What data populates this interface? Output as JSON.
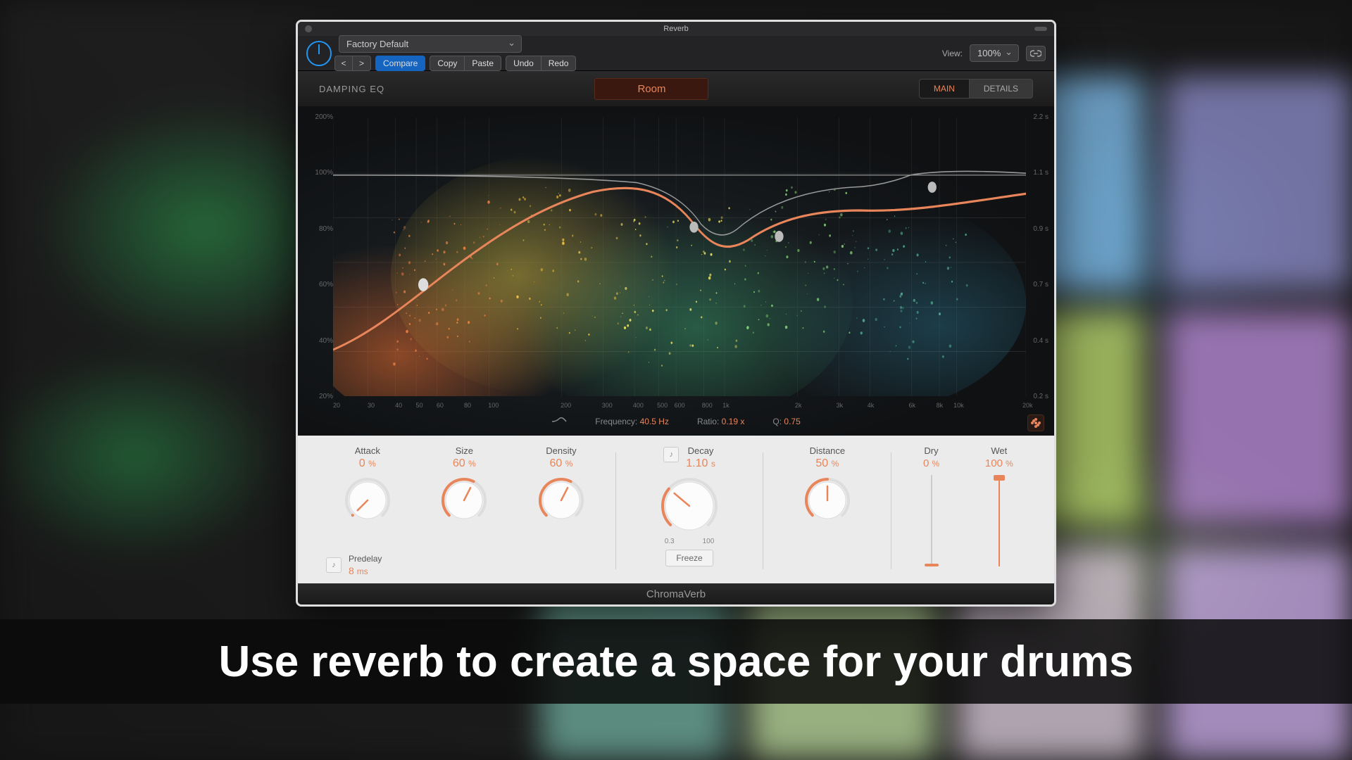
{
  "window": {
    "title": "Reverb"
  },
  "toolbar": {
    "preset": "Factory Default",
    "compare": "Compare",
    "copy": "Copy",
    "paste": "Paste",
    "undo": "Undo",
    "redo": "Redo",
    "view_label": "View:",
    "view_value": "100%"
  },
  "header": {
    "eq_label": "DAMPING EQ",
    "preset_name": "Room",
    "tab_main": "MAIN",
    "tab_details": "DETAILS"
  },
  "graph": {
    "y_left": [
      "200%",
      "100%",
      "80%",
      "60%",
      "40%",
      "20%"
    ],
    "y_right": [
      "2.2 s",
      "1.1 s",
      "0.9 s",
      "0.7 s",
      "0.4 s",
      "0.2 s"
    ],
    "x_ticks": [
      {
        "label": "20",
        "pos": 0
      },
      {
        "label": "30",
        "pos": 5
      },
      {
        "label": "40",
        "pos": 9
      },
      {
        "label": "50",
        "pos": 12
      },
      {
        "label": "60",
        "pos": 15
      },
      {
        "label": "80",
        "pos": 19
      },
      {
        "label": "100",
        "pos": 22.5
      },
      {
        "label": "200",
        "pos": 33
      },
      {
        "label": "300",
        "pos": 39
      },
      {
        "label": "400",
        "pos": 43.5
      },
      {
        "label": "500",
        "pos": 47
      },
      {
        "label": "600",
        "pos": 49.5
      },
      {
        "label": "800",
        "pos": 53.5
      },
      {
        "label": "1k",
        "pos": 56.5
      },
      {
        "label": "2k",
        "pos": 67
      },
      {
        "label": "3k",
        "pos": 73
      },
      {
        "label": "4k",
        "pos": 77.5
      },
      {
        "label": "6k",
        "pos": 83.5
      },
      {
        "label": "8k",
        "pos": 87.5
      },
      {
        "label": "10k",
        "pos": 90
      },
      {
        "label": "20k",
        "pos": 100
      }
    ],
    "readout": {
      "freq_label": "Frequency:",
      "freq_value": "40.5 Hz",
      "ratio_label": "Ratio:",
      "ratio_value": "0.19 x",
      "q_label": "Q:",
      "q_value": "0.75"
    }
  },
  "controls": {
    "attack": {
      "label": "Attack",
      "value": "0",
      "unit": "%",
      "angle": -135
    },
    "size": {
      "label": "Size",
      "value": "60",
      "unit": "%",
      "angle": 27
    },
    "density": {
      "label": "Density",
      "value": "60",
      "unit": "%",
      "angle": 27
    },
    "decay": {
      "label": "Decay",
      "value": "1.10",
      "unit": "s",
      "range_min": "0.3",
      "range_max": "100",
      "angle": -50
    },
    "distance": {
      "label": "Distance",
      "value": "50",
      "unit": "%",
      "angle": 0
    },
    "predelay": {
      "label": "Predelay",
      "value": "8",
      "unit": "ms"
    },
    "freeze": "Freeze",
    "dry": {
      "label": "Dry",
      "value": "0",
      "unit": "%",
      "pos": 0
    },
    "wet": {
      "label": "Wet",
      "value": "100",
      "unit": "%",
      "pos": 100
    }
  },
  "footer": {
    "name": "ChromaVerb"
  },
  "caption": "Use reverb to create a space for your drums"
}
